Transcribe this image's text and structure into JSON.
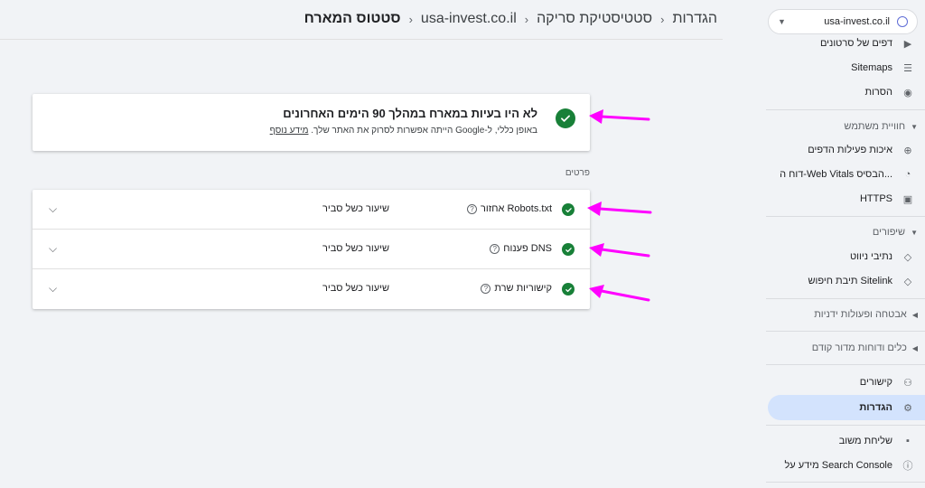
{
  "header": {
    "breadcrumb": [
      "הגדרות",
      "סטטיסטיקת סריקה",
      "usa-invest.co.il",
      "סטטוס המארח"
    ]
  },
  "property": {
    "name": "usa-invest.co.il",
    "icon": "globe-icon"
  },
  "sidebar": {
    "items_top": [
      {
        "label": "דפים של סרטונים",
        "icon": "video-page-icon"
      },
      {
        "label": "Sitemaps",
        "icon": "sitemap-icon"
      },
      {
        "label": "הסרות",
        "icon": "eye-off-icon"
      }
    ],
    "section_experience": "חוויית משתמש",
    "items_experience": [
      {
        "label": "איכות פעילות הדפים",
        "icon": "plus-circle-icon"
      },
      {
        "label": "דוח ה-Web Vitals הבסיס...",
        "icon": "gauge-icon"
      },
      {
        "label": "HTTPS",
        "icon": "lock-icon"
      }
    ],
    "section_enhancements": "שיפורים",
    "items_enhancements": [
      {
        "label": "נתיבי ניווט",
        "icon": "layers-icon"
      },
      {
        "label": "תיבת חיפוש Sitelink",
        "icon": "layers-icon"
      }
    ],
    "section_security": "אבטחה ופעולות ידניות",
    "section_legacy": "כלים ודוחות מדור קודם",
    "items_bottom": [
      {
        "label": "קישורים",
        "icon": "links-icon"
      },
      {
        "label": "הגדרות",
        "icon": "gear-icon"
      }
    ],
    "items_footer": [
      {
        "label": "שליחת משוב",
        "icon": "feedback-icon"
      },
      {
        "label": "מידע על Search Console",
        "icon": "info-icon"
      }
    ]
  },
  "summary": {
    "title": "לא היו בעיות במארח במהלך 90 הימים האחרונים",
    "subtitle": "באופן כללי, ל-Google הייתה אפשרות לסרוק את האתר שלך.",
    "more_link": "מידע נוסף"
  },
  "details": {
    "label": "פרטים",
    "rows": [
      {
        "name": "אחזור Robots.txt",
        "status": "שיעור כשל סביר"
      },
      {
        "name": "פענוח DNS",
        "status": "שיעור כשל סביר"
      },
      {
        "name": "קישוריות שרת",
        "status": "שיעור כשל סביר"
      }
    ]
  },
  "colors": {
    "success": "#188038",
    "accent": "#d3e3fd",
    "annotation_arrow": "#ff00ff"
  }
}
